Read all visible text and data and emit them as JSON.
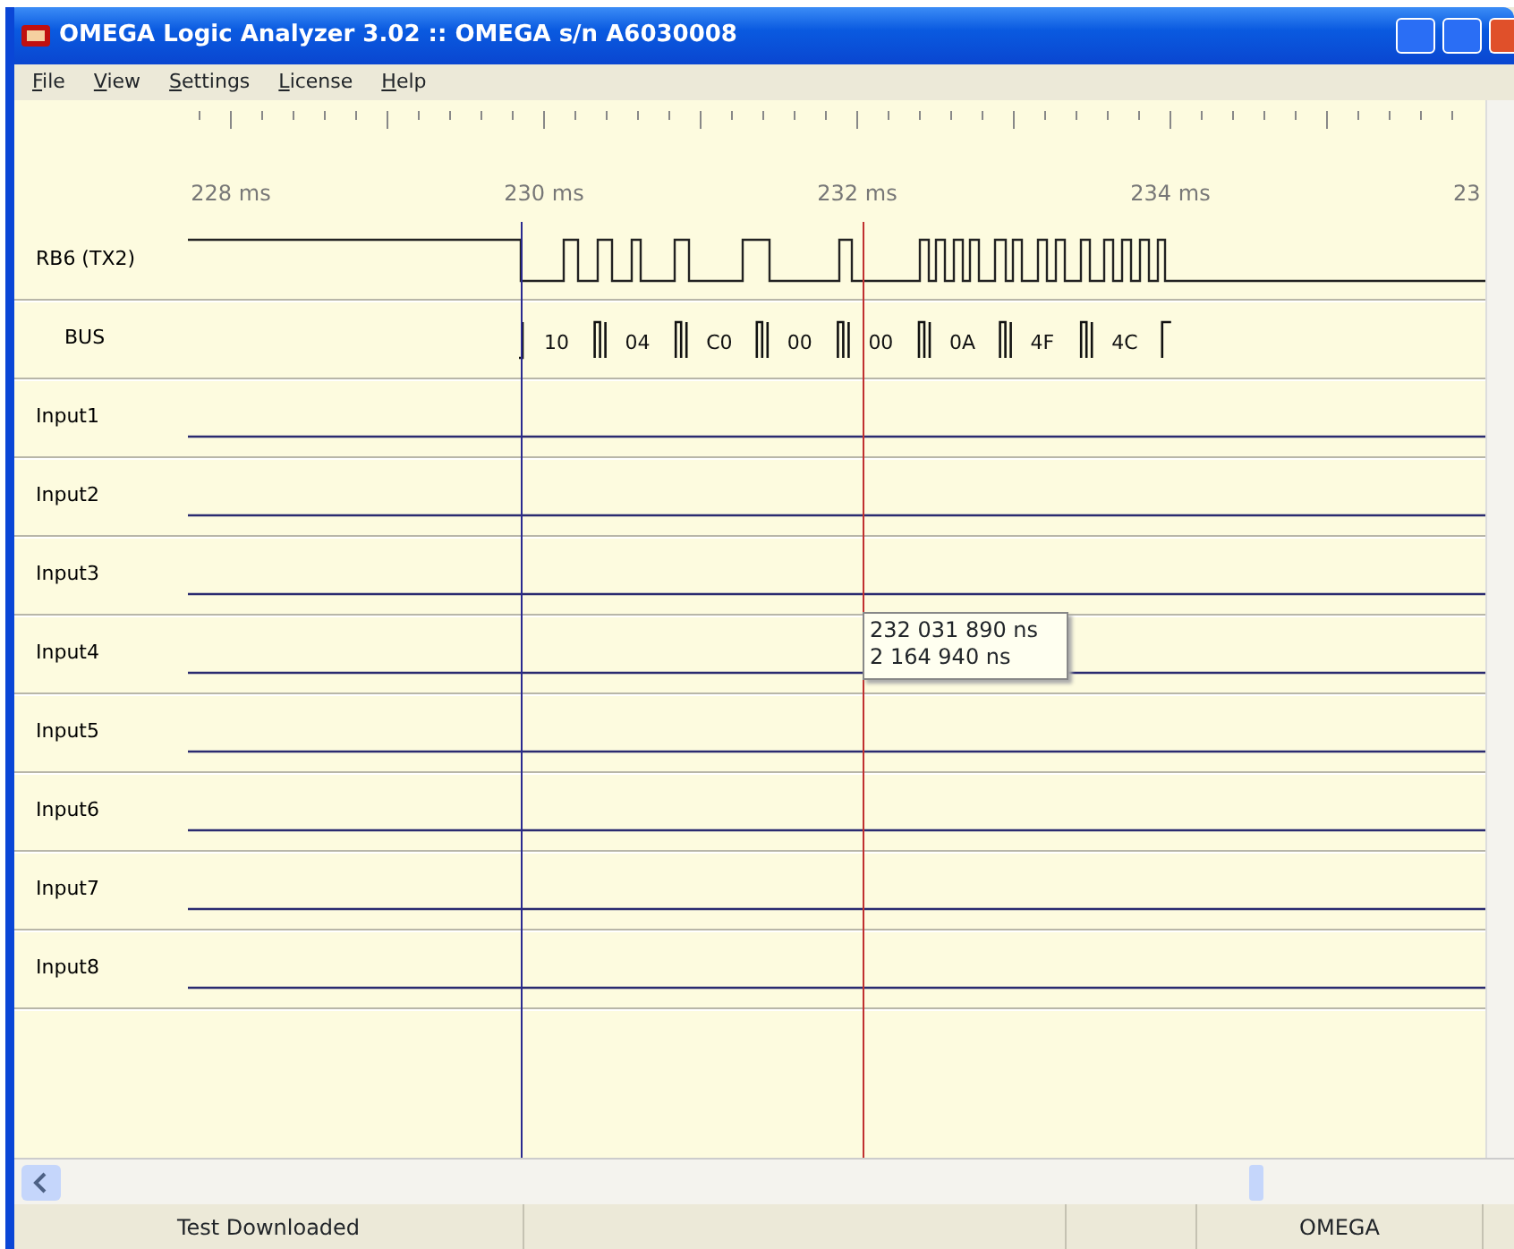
{
  "window": {
    "title": "OMEGA Logic Analyzer 3.02 :: OMEGA s/n A6030008"
  },
  "menu": [
    "File",
    "View",
    "Settings",
    "License",
    "Help"
  ],
  "ruler": {
    "labels": [
      "228 ms",
      "230 ms",
      "232 ms",
      "234 ms",
      "23"
    ]
  },
  "channels": [
    {
      "name": "RB6 (TX2)",
      "kind": "serial"
    },
    {
      "name": "BUS",
      "kind": "bus",
      "values": [
        "10",
        "04",
        "C0",
        "00",
        "00",
        "0A",
        "4F",
        "4C"
      ]
    },
    {
      "name": "Input1",
      "kind": "digital"
    },
    {
      "name": "Input2",
      "kind": "digital"
    },
    {
      "name": "Input3",
      "kind": "digital"
    },
    {
      "name": "Input4",
      "kind": "digital"
    },
    {
      "name": "Input5",
      "kind": "digital"
    },
    {
      "name": "Input6",
      "kind": "digital"
    },
    {
      "name": "Input7",
      "kind": "digital"
    },
    {
      "name": "Input8",
      "kind": "digital"
    }
  ],
  "tooltip": {
    "lines": [
      "232 031 890 ns",
      "2 164 940 ns"
    ]
  },
  "status_bar": [
    "Test Downloaded",
    "OMEGA"
  ]
}
